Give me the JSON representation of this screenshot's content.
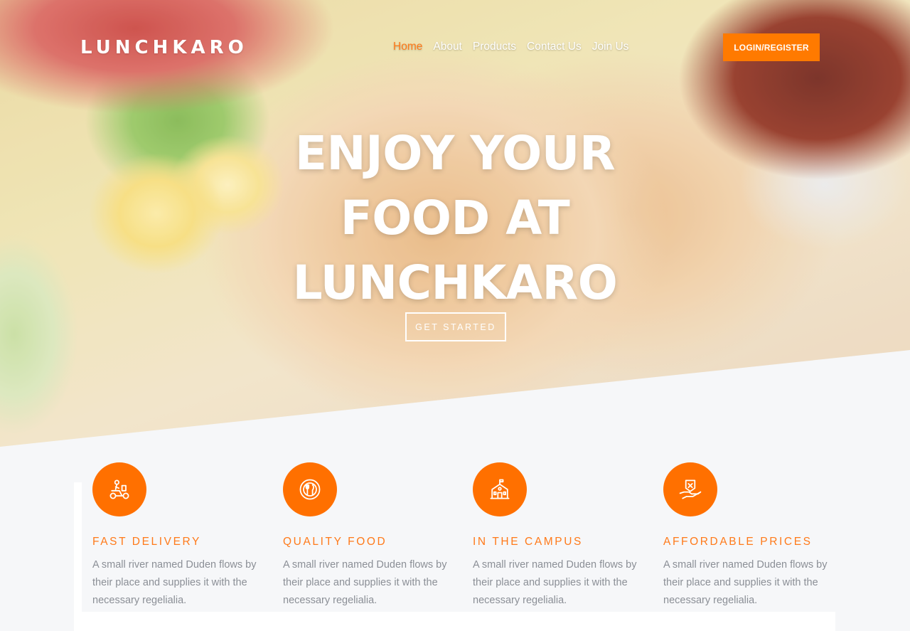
{
  "nav": {
    "logo": "LUNCHKARO",
    "menu": [
      "Home",
      "About",
      "Products",
      "Contact Us",
      "Join Us"
    ],
    "active_index": 0,
    "login_label": "LOGIN/REGISTER"
  },
  "hero": {
    "title_lines": [
      "ENJOY YOUR",
      "FOOD AT",
      "LUNCHKARO"
    ],
    "cta_label": "GET STARTED"
  },
  "features": [
    {
      "icon": "delivery-scooter-icon",
      "title": "FAST DELIVERY",
      "text": "A small river named Duden flows by their place and supplies it with the necessary regelialia."
    },
    {
      "icon": "plate-cutlery-icon",
      "title": "QUALITY FOOD",
      "text": "A small river named Duden flows by their place and supplies it with the necessary regelialia."
    },
    {
      "icon": "campus-building-icon",
      "title": "IN THE CAMPUS",
      "text": "A small river named Duden flows by their place and supplies it with the necessary regelialia."
    },
    {
      "icon": "price-hand-icon",
      "title": "AFFORDABLE PRICES",
      "text": "A small river named Duden flows by their place and supplies it with the necessary regelialia."
    }
  ],
  "colors": {
    "accent": "#ff7a00",
    "body_text": "#8b8f96",
    "section_bg": "#f6f7f9"
  }
}
